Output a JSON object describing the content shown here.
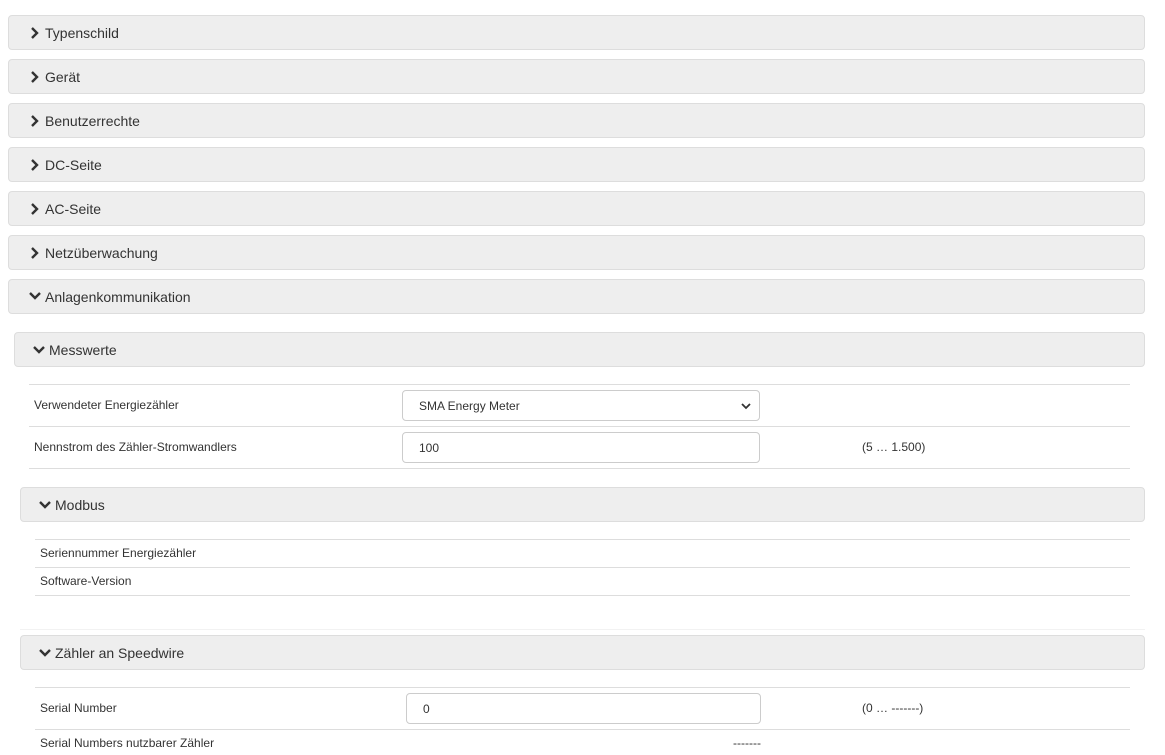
{
  "sections": [
    {
      "label": "Typenschild",
      "expanded": false
    },
    {
      "label": "Gerät",
      "expanded": false
    },
    {
      "label": "Benutzerrechte",
      "expanded": false
    },
    {
      "label": "DC-Seite",
      "expanded": false
    },
    {
      "label": "AC-Seite",
      "expanded": false
    },
    {
      "label": "Netzüberwachung",
      "expanded": false
    },
    {
      "label": "Anlagenkommunikation",
      "expanded": true
    }
  ],
  "messwerte": {
    "title": "Messwerte",
    "meter_label": "Verwendeter Energiezähler",
    "meter_value": "SMA Energy Meter",
    "current_label": "Nennstrom des Zähler-Stromwandlers",
    "current_value": "100",
    "current_range": "(5 … 1.500)"
  },
  "modbus": {
    "title": "Modbus",
    "serial_label": "Seriennummer Energiezähler",
    "software_label": "Software-Version"
  },
  "speedwire": {
    "title": "Zähler an Speedwire",
    "serial_label": "Serial Number",
    "serial_value": "0",
    "serial_range": "(0 … -------)",
    "usable_label": "Serial Numbers nutzbarer Zähler",
    "usable_value": "-------"
  }
}
